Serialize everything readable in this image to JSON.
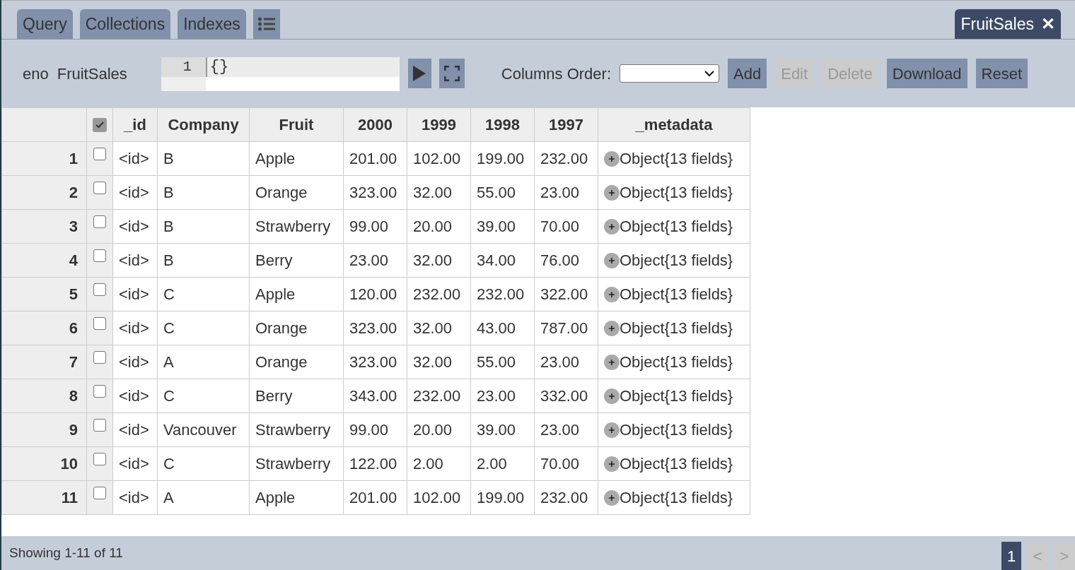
{
  "tabs": [
    {
      "label": "Query"
    },
    {
      "label": "Collections"
    },
    {
      "label": "Indexes"
    }
  ],
  "open_tab": {
    "label": "FruitSales",
    "close": "✕"
  },
  "toolbar": {
    "database": "eno",
    "collection": "FruitSales",
    "editor": {
      "line_number": "1",
      "query": "{}"
    },
    "columns_order_label": "Columns Order:",
    "buttons": [
      {
        "label": "Add",
        "disabled": false
      },
      {
        "label": "Edit",
        "disabled": true
      },
      {
        "label": "Delete",
        "disabled": true
      },
      {
        "label": "Download",
        "disabled": false
      },
      {
        "label": "Reset",
        "disabled": false
      }
    ]
  },
  "table": {
    "select_all_checked": true,
    "columns": [
      "_id",
      "Company",
      "Fruit",
      "2000",
      "1999",
      "1998",
      "1997",
      "_metadata"
    ],
    "rows": [
      {
        "number": "1",
        "checked": false,
        "cells": [
          "<id>",
          "B",
          "Apple",
          "201.00",
          "102.00",
          "199.00",
          "232.00"
        ],
        "metadata": "Object{13 fields}"
      },
      {
        "number": "2",
        "checked": false,
        "cells": [
          "<id>",
          "B",
          "Orange",
          "323.00",
          "32.00",
          "55.00",
          "23.00"
        ],
        "metadata": "Object{13 fields}"
      },
      {
        "number": "3",
        "checked": false,
        "cells": [
          "<id>",
          "B",
          "Strawberry",
          "99.00",
          "20.00",
          "39.00",
          "70.00"
        ],
        "metadata": "Object{13 fields}"
      },
      {
        "number": "4",
        "checked": false,
        "cells": [
          "<id>",
          "B",
          "Berry",
          "23.00",
          "32.00",
          "34.00",
          "76.00"
        ],
        "metadata": "Object{13 fields}"
      },
      {
        "number": "5",
        "checked": false,
        "cells": [
          "<id>",
          "C",
          "Apple",
          "120.00",
          "232.00",
          "232.00",
          "322.00"
        ],
        "metadata": "Object{13 fields}"
      },
      {
        "number": "6",
        "checked": false,
        "cells": [
          "<id>",
          "C",
          "Orange",
          "323.00",
          "32.00",
          "43.00",
          "787.00"
        ],
        "metadata": "Object{13 fields}"
      },
      {
        "number": "7",
        "checked": false,
        "cells": [
          "<id>",
          "A",
          "Orange",
          "323.00",
          "32.00",
          "55.00",
          "23.00"
        ],
        "metadata": "Object{13 fields}"
      },
      {
        "number": "8",
        "checked": false,
        "cells": [
          "<id>",
          "C",
          "Berry",
          "343.00",
          "232.00",
          "23.00",
          "332.00"
        ],
        "metadata": "Object{13 fields}"
      },
      {
        "number": "9",
        "checked": false,
        "cells": [
          "<id>",
          "Vancouver",
          "Strawberry",
          "99.00",
          "20.00",
          "39.00",
          "23.00"
        ],
        "metadata": "Object{13 fields}"
      },
      {
        "number": "10",
        "checked": false,
        "cells": [
          "<id>",
          "C",
          "Strawberry",
          "122.00",
          "2.00",
          "2.00",
          "70.00"
        ],
        "metadata": "Object{13 fields}"
      },
      {
        "number": "11",
        "checked": false,
        "cells": [
          "<id>",
          "A",
          "Apple",
          "201.00",
          "102.00",
          "199.00",
          "232.00"
        ],
        "metadata": "Object{13 fields}"
      }
    ]
  },
  "footer": {
    "summary": "Showing 1-11 of 11",
    "pages": [
      {
        "label": "1",
        "selected": true
      }
    ],
    "prev": {
      "label": "<",
      "disabled": true
    },
    "next": {
      "label": ">",
      "disabled": true
    }
  }
}
